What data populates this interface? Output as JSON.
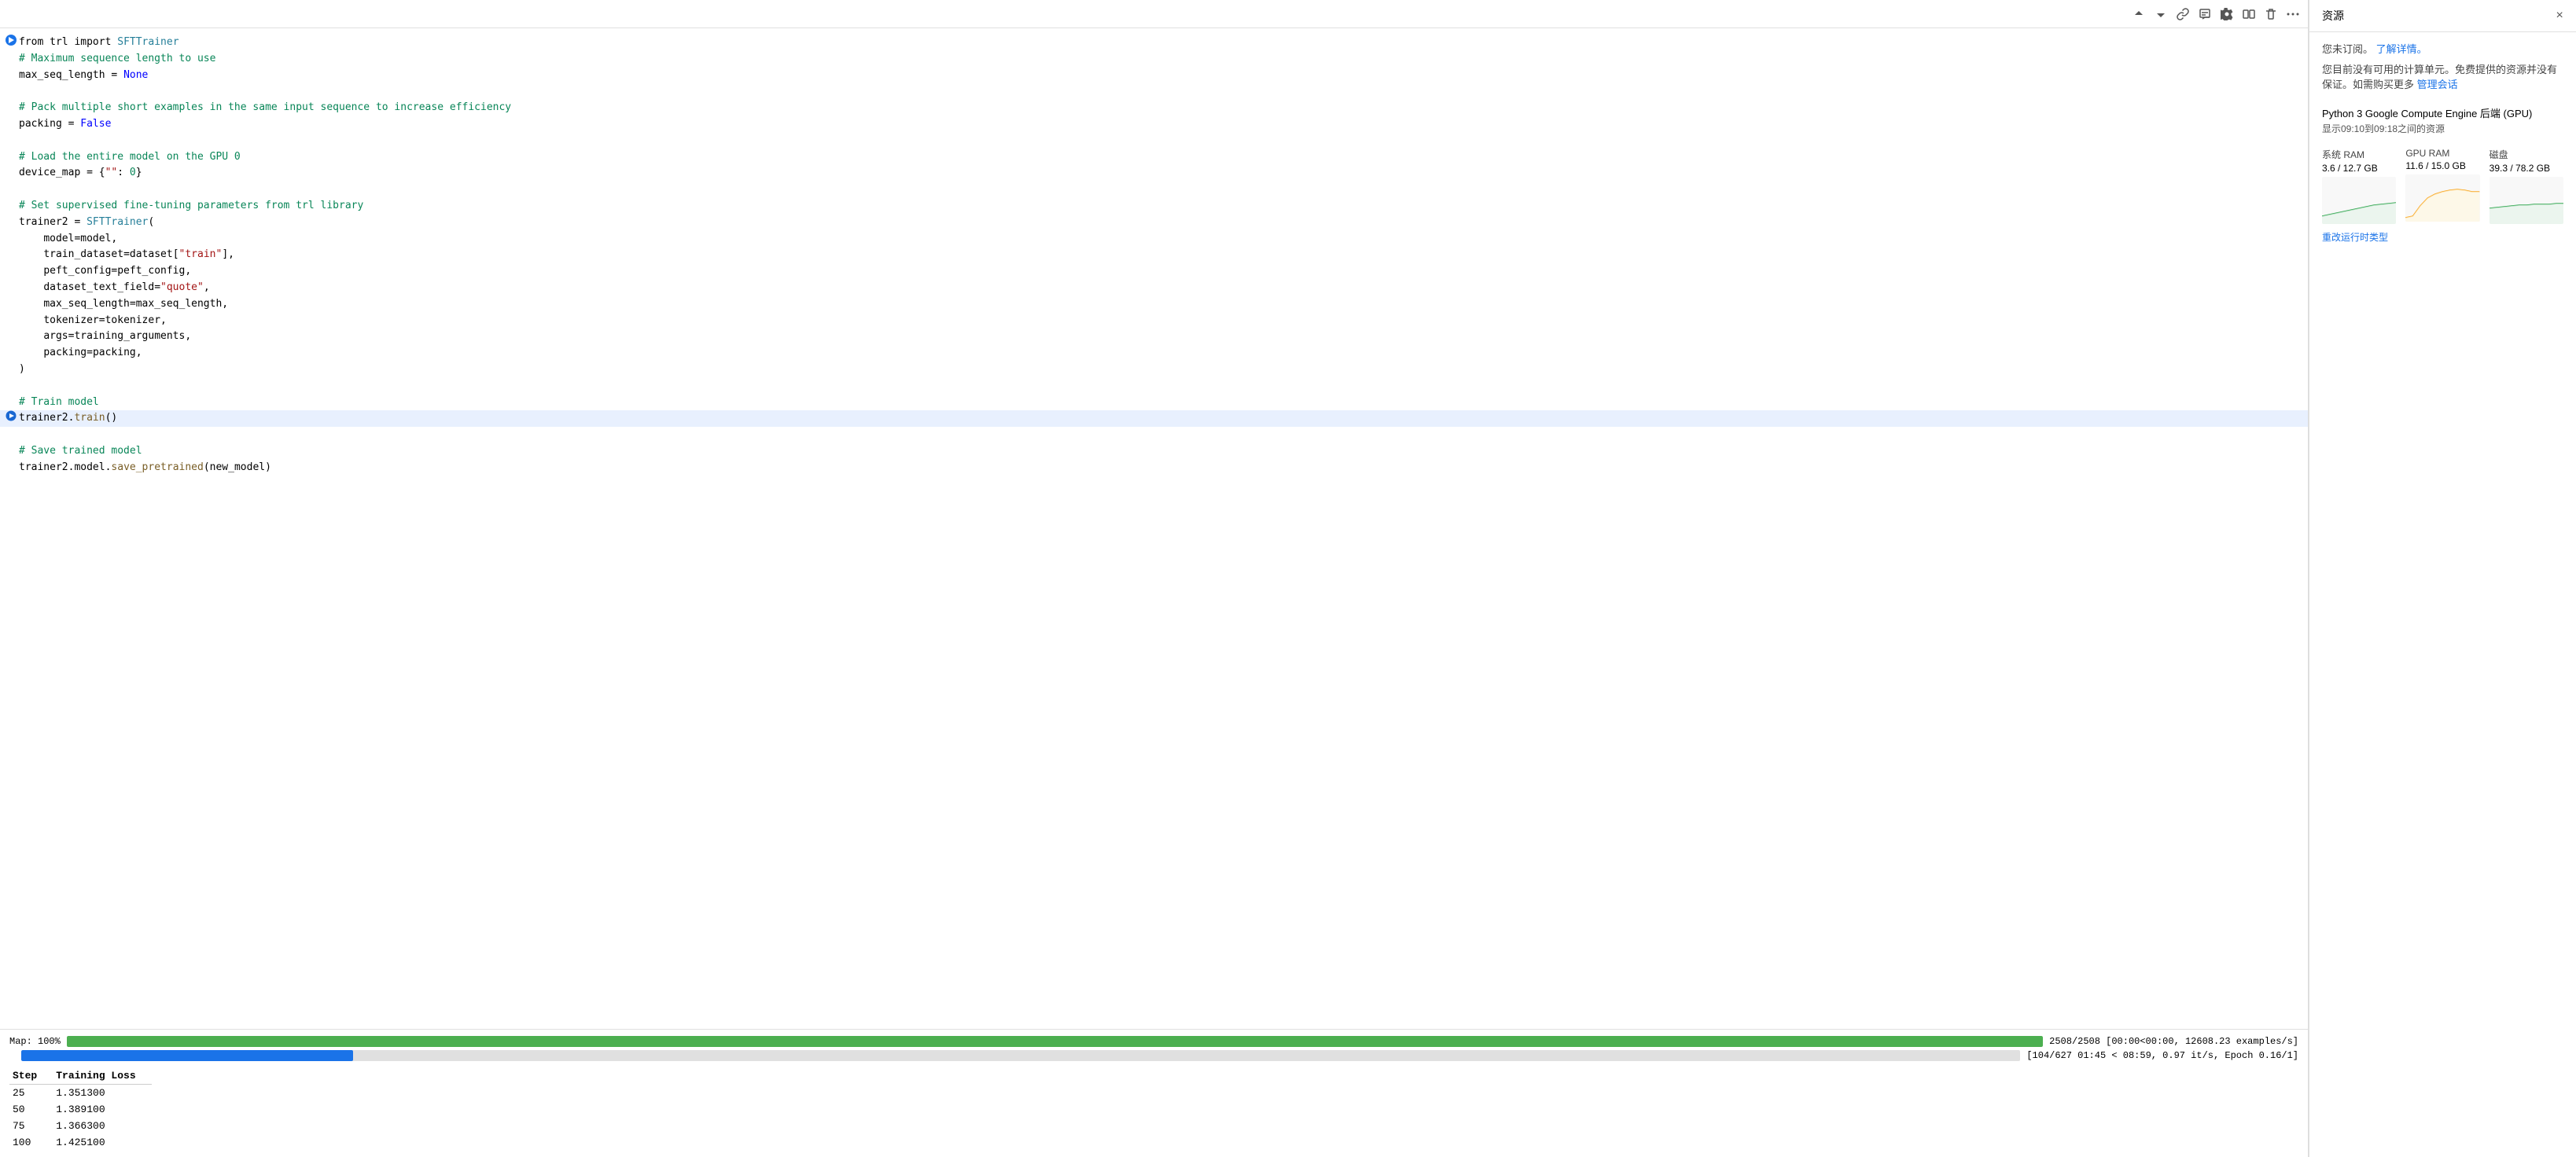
{
  "toolbar": {
    "move_up_label": "↑",
    "move_down_label": "↓",
    "link_label": "🔗",
    "comment_label": "💬",
    "settings_label": "⚙",
    "mirror_label": "⧉",
    "delete_label": "🗑",
    "more_label": "⋯"
  },
  "code": {
    "lines": [
      {
        "text": "from trl import SFTTrainer",
        "highlight": false
      },
      {
        "text": "# Maximum sequence length to use",
        "type": "comment"
      },
      {
        "text": "max_seq_length = None",
        "type": "mixed"
      },
      {
        "text": "",
        "type": "empty"
      },
      {
        "text": "# Pack multiple short examples in the same input sequence to increase efficiency",
        "type": "comment"
      },
      {
        "text": "packing = False",
        "type": "mixed"
      },
      {
        "text": "",
        "type": "empty"
      },
      {
        "text": "# Load the entire model on the GPU 0",
        "type": "comment"
      },
      {
        "text": "device_map = {\"\": 0}",
        "type": "mixed"
      },
      {
        "text": "",
        "type": "empty"
      },
      {
        "text": "# Set supervised fine-tuning parameters from trl library",
        "type": "comment"
      },
      {
        "text": "trainer2 = SFTTrainer(",
        "type": "mixed"
      },
      {
        "text": "    model=model,",
        "type": "indent"
      },
      {
        "text": "    train_dataset=dataset[\"train\"],",
        "type": "indent"
      },
      {
        "text": "    peft_config=peft_config,",
        "type": "indent"
      },
      {
        "text": "    dataset_text_field=\"quote\",",
        "type": "indent"
      },
      {
        "text": "    max_seq_length=max_seq_length,",
        "type": "indent"
      },
      {
        "text": "    tokenizer=tokenizer,",
        "type": "indent"
      },
      {
        "text": "    args=training_arguments,",
        "type": "indent"
      },
      {
        "text": "    packing=packing,",
        "type": "indent"
      },
      {
        "text": ")",
        "type": "plain"
      },
      {
        "text": "",
        "type": "empty"
      },
      {
        "text": "# Train model",
        "type": "comment"
      },
      {
        "text": "trainer2.train()",
        "type": "plain",
        "active": true
      },
      {
        "text": "",
        "type": "empty"
      },
      {
        "text": "# Save trained model",
        "type": "comment"
      },
      {
        "text": "trainer2.model.save_pretrained(new_model)",
        "type": "plain"
      }
    ]
  },
  "output": {
    "map_progress": {
      "label": "Map: 100%",
      "fill_percent": 100,
      "info": "2508/2508 [00:00<00:00, 12608.23 examples/s]"
    },
    "train_progress": {
      "label": "",
      "fill_percent": 16.6,
      "info": "[104/627 01:45 < 08:59, 0.97 it/s, Epoch 0.16/1]"
    },
    "table": {
      "headers": [
        "Step",
        "Training Loss"
      ],
      "rows": [
        {
          "step": "25",
          "loss": "1.351300"
        },
        {
          "step": "50",
          "loss": "1.389100"
        },
        {
          "step": "75",
          "loss": "1.366300"
        },
        {
          "step": "100",
          "loss": "1.425100"
        }
      ]
    }
  },
  "resources": {
    "title": "资源",
    "close_label": "×",
    "subscribe_text": "您未订阅。",
    "subscribe_link": "了解详情。",
    "notice_text": "您目前没有可用的计算单元。免费提供的资源并没有保证。如需购买更多",
    "manage_link": "管理会话",
    "backend_title": "Python 3 Google Compute Engine 后端 (GPU)",
    "backend_subtitle": "显示09:10到09:18之间的资源",
    "system_ram": {
      "label": "系统 RAM",
      "value": "3.6 / 12.7 GB"
    },
    "gpu_ram": {
      "label": "GPU RAM",
      "value": "11.6 / 15.0 GB"
    },
    "disk": {
      "label": "磁盘",
      "value": "39.3 / 78.2 GB"
    },
    "change_runtime": "重改运行时类型"
  }
}
